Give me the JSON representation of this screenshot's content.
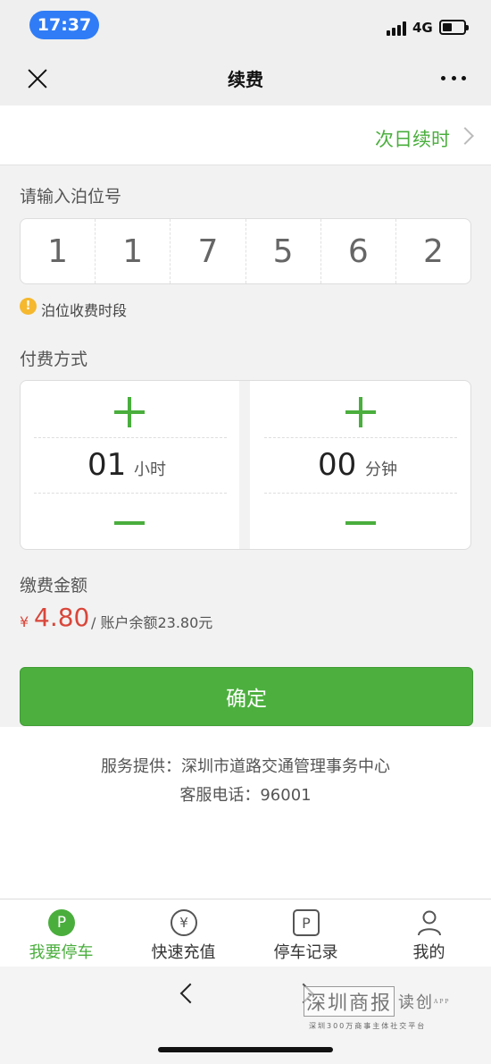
{
  "status_bar": {
    "time": "17:37",
    "network": "4G"
  },
  "header": {
    "title": "续费"
  },
  "next_day": {
    "label": "次日续时"
  },
  "berth": {
    "label": "请输入泊位号",
    "digits": [
      "1",
      "1",
      "7",
      "5",
      "6",
      "2"
    ],
    "fee_period_link": "泊位收费时段"
  },
  "payment": {
    "label": "付费方式",
    "hours": {
      "value": "01",
      "unit": "小时"
    },
    "minutes": {
      "value": "00",
      "unit": "分钟"
    }
  },
  "amount": {
    "label": "缴费金额",
    "currency": "¥",
    "value": "4.80",
    "balance_text": "/ 账户余额23.80元"
  },
  "confirm_button": "确定",
  "footer_info": {
    "provider": "服务提供：深圳市道路交通管理事务中心",
    "hotline": "客服电话：96001"
  },
  "tabs": [
    {
      "label": "我要停车",
      "icon": "parking-filled-icon",
      "icon_text": "P"
    },
    {
      "label": "快速充值",
      "icon": "yen-circle-icon",
      "icon_text": "¥"
    },
    {
      "label": "停车记录",
      "icon": "parking-record-icon",
      "icon_text": "P"
    },
    {
      "label": "我的",
      "icon": "user-icon"
    }
  ],
  "watermark": {
    "main": "深圳商报",
    "side": "读创",
    "badge": "APP",
    "sub": "深圳300万商事主体社交平台"
  },
  "colors": {
    "accent_green": "#4aae3d",
    "price_red": "#d9463a",
    "time_pill_blue": "#2f7cf6"
  }
}
